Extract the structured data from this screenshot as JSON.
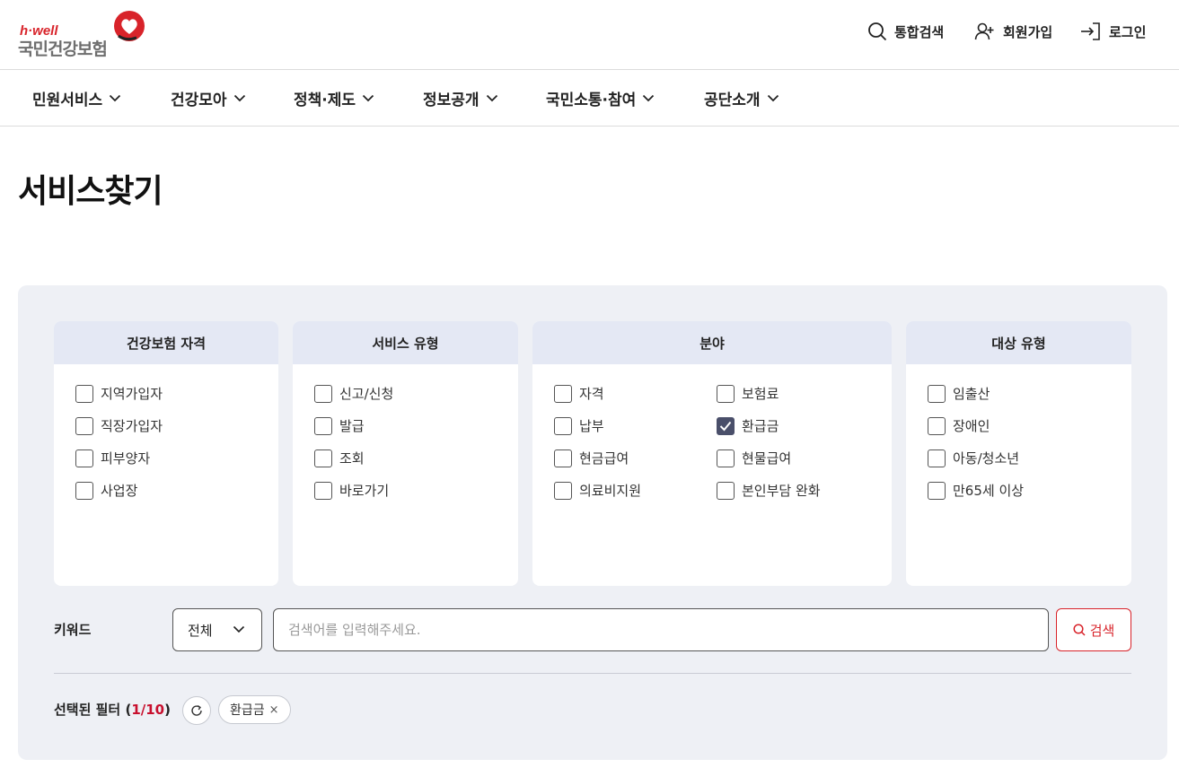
{
  "header": {
    "logo_tagline": "h·well",
    "logo_name": "국민건강보험",
    "utility": {
      "search": "통합검색",
      "join": "회원가입",
      "login": "로그인"
    }
  },
  "nav": {
    "items": [
      "민원서비스",
      "건강모아",
      "정책·제도",
      "정보공개",
      "국민소통·참여",
      "공단소개"
    ]
  },
  "page": {
    "title": "서비스찾기"
  },
  "filters": {
    "eligibility": {
      "title": "건강보험 자격",
      "options": [
        {
          "label": "지역가입자",
          "checked": false
        },
        {
          "label": "직장가입자",
          "checked": false
        },
        {
          "label": "피부양자",
          "checked": false
        },
        {
          "label": "사업장",
          "checked": false
        }
      ]
    },
    "service_type": {
      "title": "서비스 유형",
      "options": [
        {
          "label": "신고/신청",
          "checked": false
        },
        {
          "label": "발급",
          "checked": false
        },
        {
          "label": "조회",
          "checked": false
        },
        {
          "label": "바로가기",
          "checked": false
        }
      ]
    },
    "field": {
      "title": "분야",
      "options": [
        {
          "label": "자격",
          "checked": false
        },
        {
          "label": "보험료",
          "checked": false
        },
        {
          "label": "납부",
          "checked": false
        },
        {
          "label": "환급금",
          "checked": true
        },
        {
          "label": "현금급여",
          "checked": false
        },
        {
          "label": "현물급여",
          "checked": false
        },
        {
          "label": "의료비지원",
          "checked": false
        },
        {
          "label": "본인부담 완화",
          "checked": false
        }
      ]
    },
    "target_type": {
      "title": "대상 유형",
      "options": [
        {
          "label": "임출산",
          "checked": false
        },
        {
          "label": "장애인",
          "checked": false
        },
        {
          "label": "아동/청소년",
          "checked": false
        },
        {
          "label": "만65세 이상",
          "checked": false
        }
      ]
    }
  },
  "keyword": {
    "label": "키워드",
    "select_value": "전체",
    "input_value": "",
    "placeholder": "검색어를 입력해주세요.",
    "search_button": "검색"
  },
  "selected": {
    "label": "선택된 필터",
    "count": "1/10",
    "chips": [
      {
        "label": "환급금"
      }
    ]
  },
  "colors": {
    "brand_red": "#d8232a",
    "panel_bg": "#eef0f5",
    "card_header_bg": "#e4e8f4",
    "checked_bg": "#4a4f6a"
  }
}
